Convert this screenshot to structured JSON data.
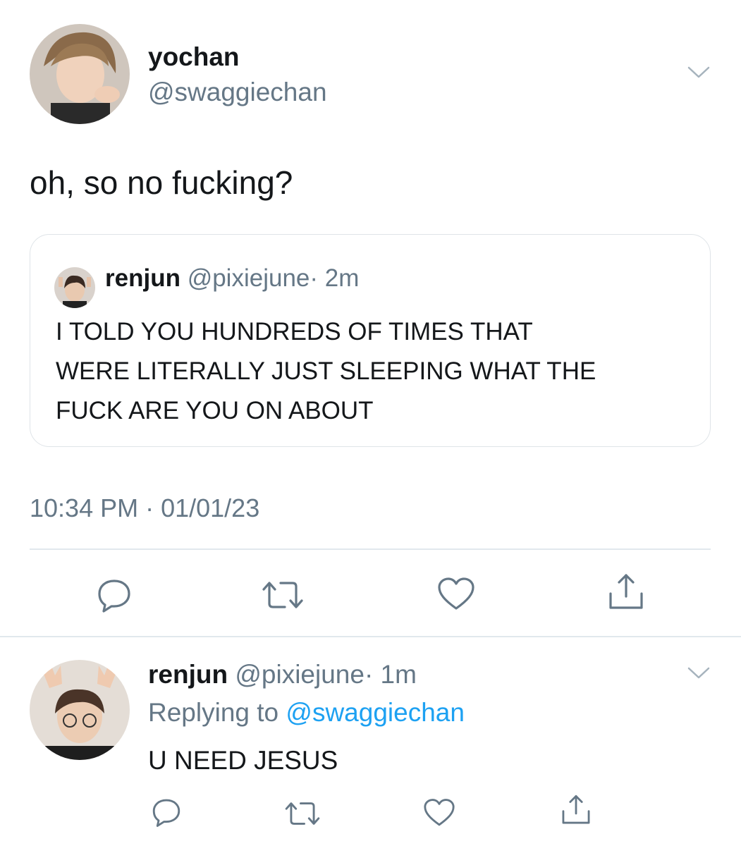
{
  "tweet": {
    "author_name": "yochan",
    "author_handle": "@swaggiechan",
    "text": "oh, so no fucking?",
    "timestamp": "10:34 PM · 01/01/23",
    "quoted": {
      "author_name": "renjun",
      "author_handle": "@pixiejune",
      "age": "· 2m",
      "lines": [
        "I TOLD YOU HUNDREDS OF TIMES THAT",
        "WERE LITERALLY JUST SLEEPING WHAT THE",
        "FUCK ARE YOU ON ABOUT"
      ]
    },
    "actions": [
      "reply-icon",
      "retweet-icon",
      "like-icon",
      "share-icon"
    ]
  },
  "reply": {
    "author_name": "renjun",
    "author_handle": "@pixiejune",
    "age": "· 1m",
    "replying_prefix": "Replying to",
    "replying_to": "@swaggiechan",
    "text": "U NEED JESUS",
    "actions": [
      "reply-icon",
      "retweet-icon",
      "like-icon",
      "share-icon"
    ]
  },
  "colors": {
    "text": "#14171a",
    "muted": "#657786",
    "link": "#1da1f2",
    "border": "#e1e8ed",
    "icon": "#657786"
  }
}
